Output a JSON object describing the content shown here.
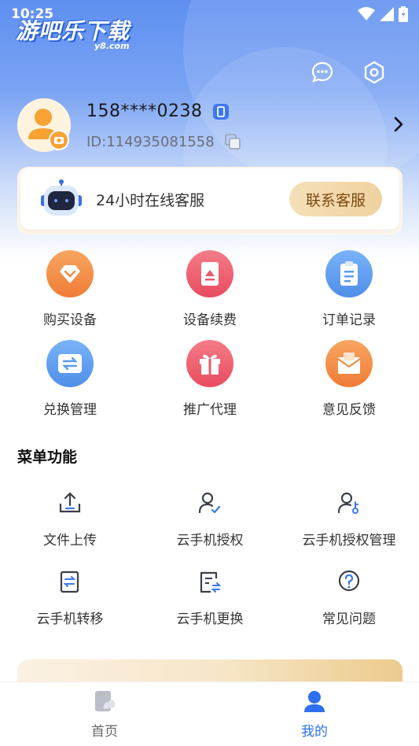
{
  "status": {
    "time": "10:25"
  },
  "watermark": {
    "text": "游吧乐下载",
    "sub": "y8.com"
  },
  "profile": {
    "phone": "158****0238",
    "id": "ID:114935081558"
  },
  "service": {
    "text": "24小时在线客服",
    "button": "联系客服"
  },
  "quick_actions": [
    {
      "label": "购买设备",
      "icon": "buy-device-icon",
      "color": "#f39248"
    },
    {
      "label": "设备续费",
      "icon": "renew-icon",
      "color": "#ee5c6e"
    },
    {
      "label": "订单记录",
      "icon": "order-icon",
      "color": "#5a9cf0"
    },
    {
      "label": "兑换管理",
      "icon": "exchange-icon",
      "color": "#5a9cf0"
    },
    {
      "label": "推广代理",
      "icon": "gift-icon",
      "color": "#ee5c6e"
    },
    {
      "label": "意见反馈",
      "icon": "feedback-icon",
      "color": "#f39248"
    }
  ],
  "menu": {
    "title": "菜单功能",
    "items": [
      {
        "label": "文件上传",
        "icon": "upload-icon"
      },
      {
        "label": "云手机授权",
        "icon": "user-check-icon"
      },
      {
        "label": "云手机授权管理",
        "icon": "user-key-icon"
      },
      {
        "label": "云手机转移",
        "icon": "transfer-icon"
      },
      {
        "label": "云手机更换",
        "icon": "replace-icon"
      },
      {
        "label": "常见问题",
        "icon": "question-icon"
      }
    ]
  },
  "nav": {
    "home": "首页",
    "mine": "我的",
    "active_color": "#2e6ff0",
    "inactive_color": "#666666"
  }
}
